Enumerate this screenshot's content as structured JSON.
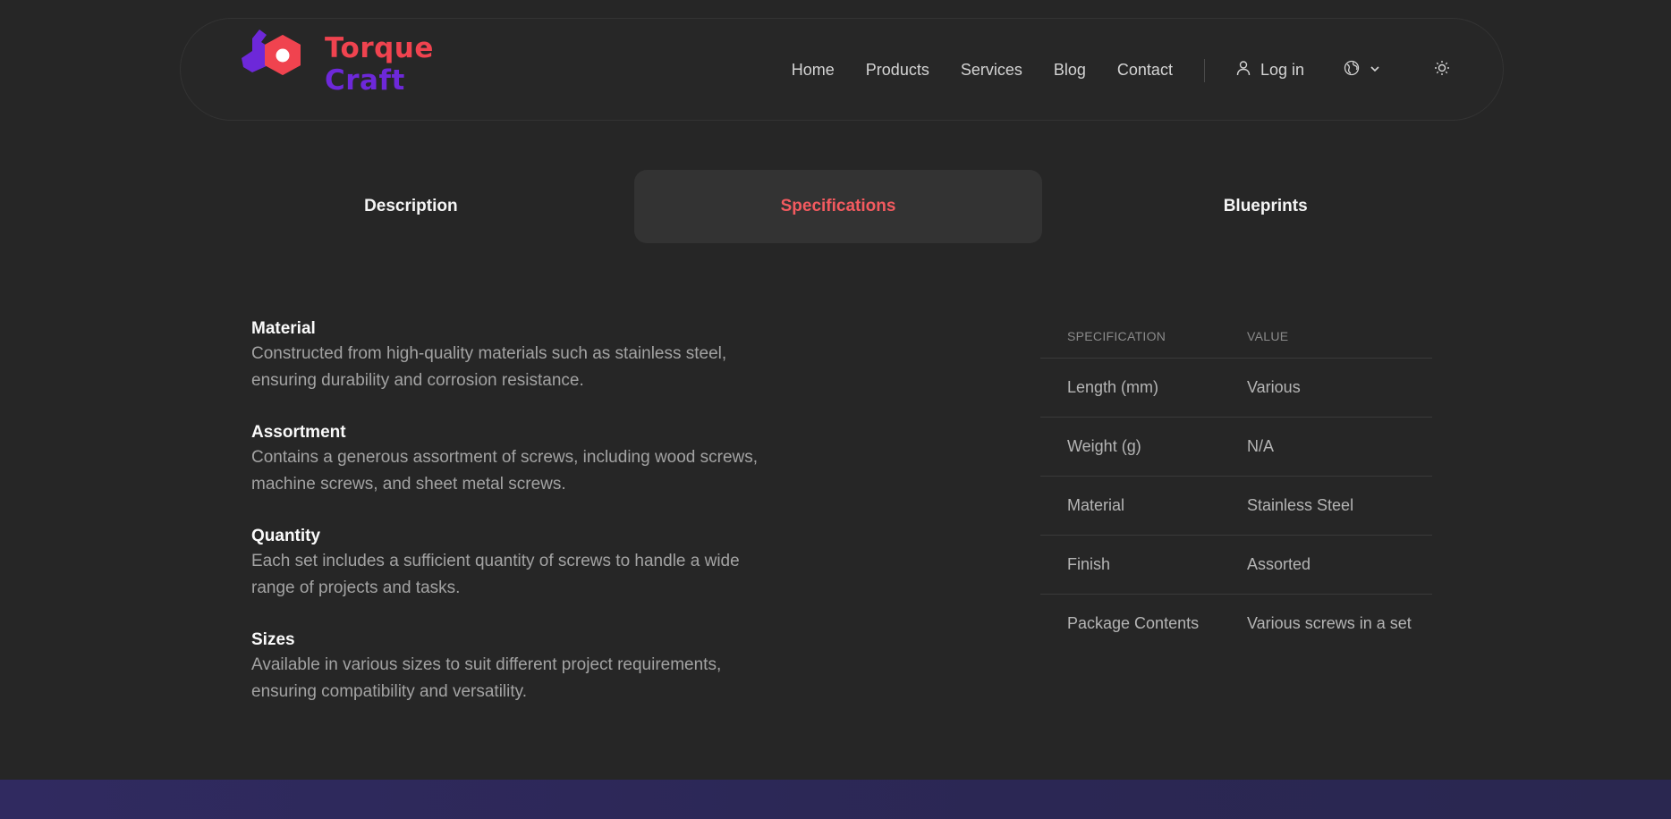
{
  "brand": {
    "line1": "Torque",
    "line2": "Craft",
    "colors": {
      "primary": "#f0434f",
      "secondary": "#6d28d9"
    }
  },
  "nav": {
    "items": [
      "Home",
      "Products",
      "Services",
      "Blog",
      "Contact"
    ],
    "login": "Log in",
    "icons": {
      "user": "user-icon",
      "globe": "globe-icon",
      "chevron": "chevron-down-icon",
      "theme": "sun-icon"
    }
  },
  "tabs": [
    {
      "label": "Description",
      "active": false
    },
    {
      "label": "Specifications",
      "active": true
    },
    {
      "label": "Blueprints",
      "active": false
    }
  ],
  "features": [
    {
      "title": "Material",
      "text": "Constructed from high-quality materials such as stainless steel, ensuring durability and corrosion resistance."
    },
    {
      "title": "Assortment",
      "text": "Contains a generous assortment of screws, including wood screws, machine screws, and sheet metal screws."
    },
    {
      "title": "Quantity",
      "text": "Each set includes a sufficient quantity of screws to handle a wide range of projects and tasks."
    },
    {
      "title": "Sizes",
      "text": "Available in various sizes to suit different project requirements, ensuring compatibility and versatility."
    }
  ],
  "spec_table": {
    "headers": [
      "SPECIFICATION",
      "VALUE"
    ],
    "rows": [
      [
        "Length (mm)",
        "Various"
      ],
      [
        "Weight (g)",
        "N/A"
      ],
      [
        "Material",
        "Stainless Steel"
      ],
      [
        "Finish",
        "Assorted"
      ],
      [
        "Package Contents",
        "Various screws in a set"
      ]
    ]
  },
  "colors": {
    "accent": "#f35a5f",
    "background": "#262626"
  }
}
